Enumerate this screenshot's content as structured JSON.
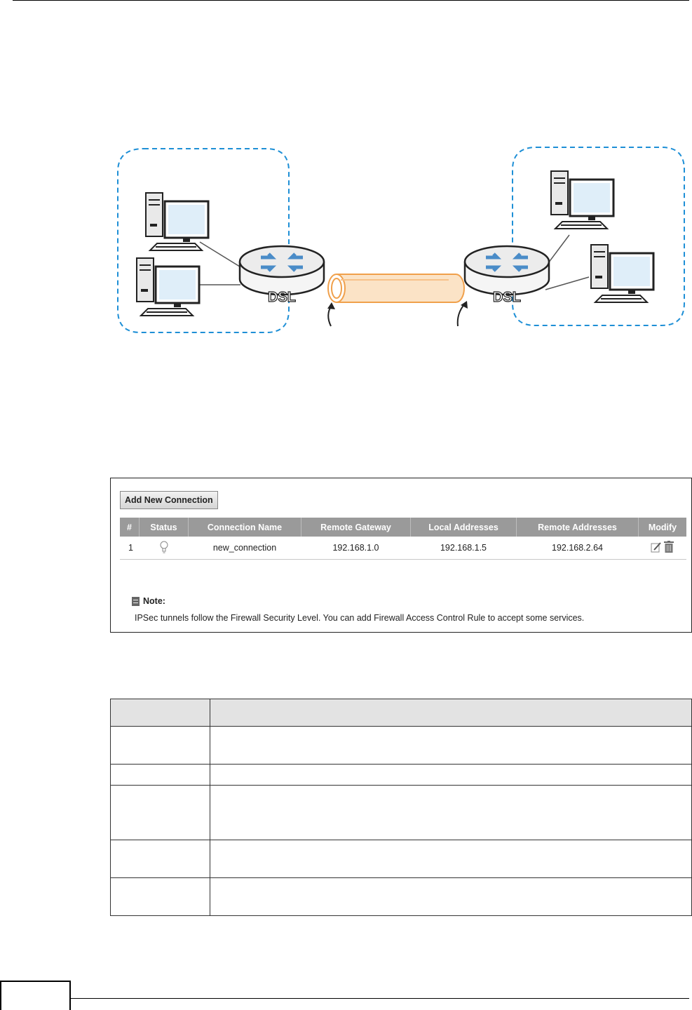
{
  "diagram": {
    "routers": [
      {
        "label": "DSL"
      },
      {
        "label": "DSL"
      }
    ]
  },
  "screen": {
    "add_button": "Add New Connection",
    "columns": [
      "#",
      "Status",
      "Connection Name",
      "Remote Gateway",
      "Local Addresses",
      "Remote Addresses",
      "Modify"
    ],
    "rows": [
      {
        "num": "1",
        "status_icon": "bulb-icon",
        "name": "new_connection",
        "gateway": "192.168.1.0",
        "local": "192.168.1.5",
        "remote": "192.168.2.64"
      }
    ],
    "note_label": "Note:",
    "note_text": "IPSec tunnels follow the Firewall Security Level. You can add Firewall Access Control Rule to accept some services."
  },
  "colors": {
    "zone_border": "#1e8fd6",
    "tunnel": "#f0a04b",
    "header_gray": "#9a9a9a"
  }
}
